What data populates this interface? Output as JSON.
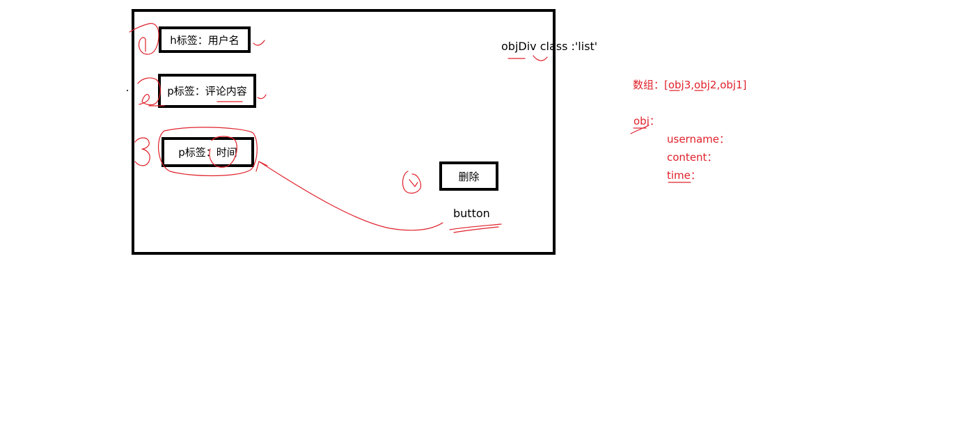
{
  "diagram": {
    "boxes": {
      "h_tag": "h标签：用户名",
      "p_comment": "p标签：评论内容",
      "p_time": "p标签：时间",
      "delete_button": "删除"
    },
    "labels": {
      "obj_div": "objDiv class :'list'",
      "button": "button"
    },
    "annotations": {
      "array_line": "数组：[obj3,obj2,obj1]",
      "obj": "obj：",
      "fields": [
        "username：",
        "content：",
        "time："
      ]
    },
    "colors": {
      "ink": "#000000",
      "annotation": "#e0202a"
    }
  }
}
